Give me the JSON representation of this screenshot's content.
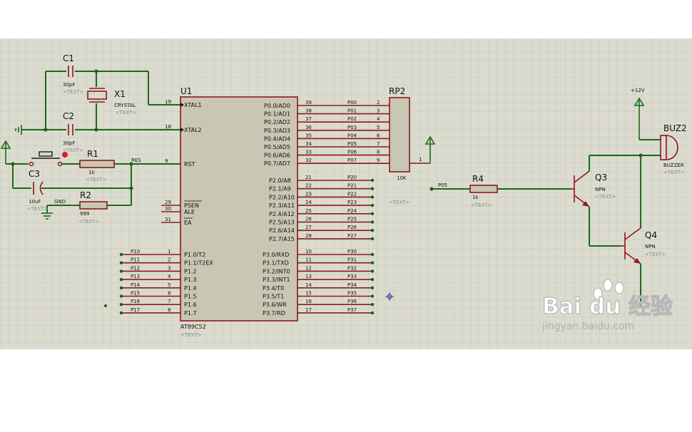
{
  "labels": {
    "C1": "C1",
    "C1_val": "30pF",
    "X1": "X1",
    "X1_type": "CRYSTAL",
    "C2": "C2",
    "C2_val": "30pF",
    "C3": "C3",
    "C3_val": "10uF",
    "R1": "R1",
    "R1_val": "1k",
    "R2": "R2",
    "R2_val": "999",
    "RES": "RES",
    "GND": "GND",
    "U1": "U1",
    "U1_part": "AT89C52",
    "RP2": "RP2",
    "RP2_val": "10K",
    "RP2_pin1": "1",
    "R4": "R4",
    "R4_val": "1k",
    "P05": "P05",
    "Q3": "Q3",
    "Q3_type": "NPN",
    "Q4": "Q4",
    "Q4_type": "NPN",
    "BUZ2": "BUZ2",
    "BUZ2_type": "BUZZER",
    "V12": "+12V",
    "text_ph": "<TEXT>"
  },
  "left_pins": [
    {
      "name": "XTAL1",
      "num": "19"
    },
    {
      "name": "XTAL2",
      "num": "18"
    },
    {
      "name": "RST",
      "num": "9"
    },
    {
      "name": "PSEN",
      "num": "29"
    },
    {
      "name": "ALE",
      "num": "30"
    },
    {
      "name": "EA",
      "num": "31"
    }
  ],
  "p1_pins": [
    {
      "name": "P1.0/T2",
      "num": "1",
      "net": "P10"
    },
    {
      "name": "P1.1/T2EX",
      "num": "2",
      "net": "P11"
    },
    {
      "name": "P1.2",
      "num": "3",
      "net": "P12"
    },
    {
      "name": "P1.3",
      "num": "4",
      "net": "P13"
    },
    {
      "name": "P1.4",
      "num": "5",
      "net": "P14"
    },
    {
      "name": "P1.5",
      "num": "6",
      "net": "P15"
    },
    {
      "name": "P1.6",
      "num": "7",
      "net": "P16"
    },
    {
      "name": "P1.7",
      "num": "8",
      "net": "P17"
    }
  ],
  "p0_pins": [
    {
      "name": "P0.0/AD0",
      "num": "39",
      "net": "P00",
      "rp": "2"
    },
    {
      "name": "P0.1/AD1",
      "num": "38",
      "net": "P01",
      "rp": "3"
    },
    {
      "name": "P0.2/AD2",
      "num": "37",
      "net": "P02",
      "rp": "4"
    },
    {
      "name": "P0.3/AD3",
      "num": "36",
      "net": "P03",
      "rp": "5"
    },
    {
      "name": "P0.4/AD4",
      "num": "35",
      "net": "P04",
      "rp": "6"
    },
    {
      "name": "P0.5/AD5",
      "num": "34",
      "net": "P05",
      "rp": "7"
    },
    {
      "name": "P0.6/AD6",
      "num": "33",
      "net": "P06",
      "rp": "8"
    },
    {
      "name": "P0.7/AD7",
      "num": "32",
      "net": "P07",
      "rp": "9"
    }
  ],
  "p2_pins": [
    {
      "name": "P2.0/A8",
      "num": "21",
      "net": "P20"
    },
    {
      "name": "P2.1/A9",
      "num": "22",
      "net": "P21"
    },
    {
      "name": "P2.2/A10",
      "num": "23",
      "net": "P22"
    },
    {
      "name": "P2.3/A11",
      "num": "24",
      "net": "P23"
    },
    {
      "name": "P2.4/A12",
      "num": "25",
      "net": "P24"
    },
    {
      "name": "P2.5/A13",
      "num": "26",
      "net": "P25"
    },
    {
      "name": "P2.6/A14",
      "num": "27",
      "net": "P26"
    },
    {
      "name": "P2.7/A15",
      "num": "28",
      "net": "P27"
    }
  ],
  "p3_pins": [
    {
      "name": "P3.0/RXD",
      "num": "10",
      "net": "P30"
    },
    {
      "name": "P3.1/TXD",
      "num": "11",
      "net": "P31"
    },
    {
      "name": "P3.2/INT0",
      "num": "12",
      "net": "P32"
    },
    {
      "name": "P3.3/INT1",
      "num": "13",
      "net": "P33"
    },
    {
      "name": "P3.4/T0",
      "num": "14",
      "net": "P34"
    },
    {
      "name": "P3.5/T1",
      "num": "15",
      "net": "P35"
    },
    {
      "name": "P3.6/WR",
      "num": "16",
      "net": "P36"
    },
    {
      "name": "P3.7/RD",
      "num": "17",
      "net": "P37"
    }
  ],
  "watermark": {
    "logo": "Bai du 经验",
    "url": "jingyan.baidu.com"
  },
  "colors": {
    "grid_bg": "#dcdbcf",
    "wire": "#1a6b1a",
    "component": "#8b1a1a",
    "chip_fill": "#c9c6b4"
  }
}
